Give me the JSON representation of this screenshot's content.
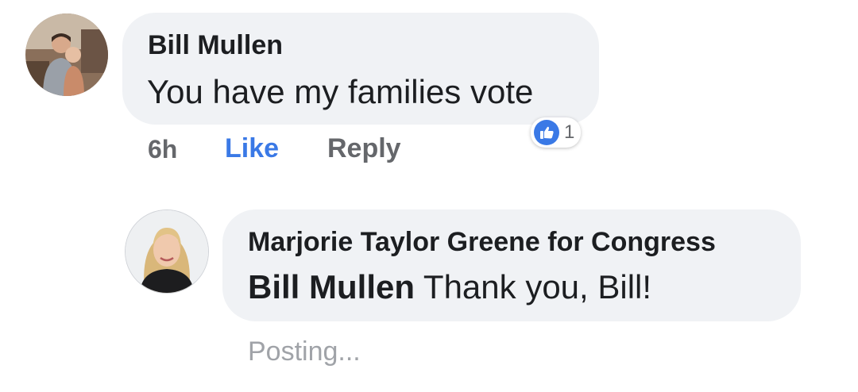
{
  "colors": {
    "bubble": "#f0f2f5",
    "text": "#1c1e21",
    "muted": "#65676b",
    "like_blue": "#3a79e6",
    "posting_gray": "#a0a3a8"
  },
  "comment": {
    "author": "Bill Mullen",
    "text": "You have my families vote",
    "avatar_icon": "profile-photo-father-with-child",
    "time": "6h",
    "like_label": "Like",
    "reply_label": "Reply",
    "reaction_icon": "thumbs-up-icon",
    "reaction_count": "1"
  },
  "reply": {
    "author": "Marjorie Taylor Greene for Congress",
    "mention": "Bill Mullen",
    "text": "Thank you, Bill!",
    "avatar_icon": "profile-photo-blonde-woman",
    "status": "Posting..."
  }
}
